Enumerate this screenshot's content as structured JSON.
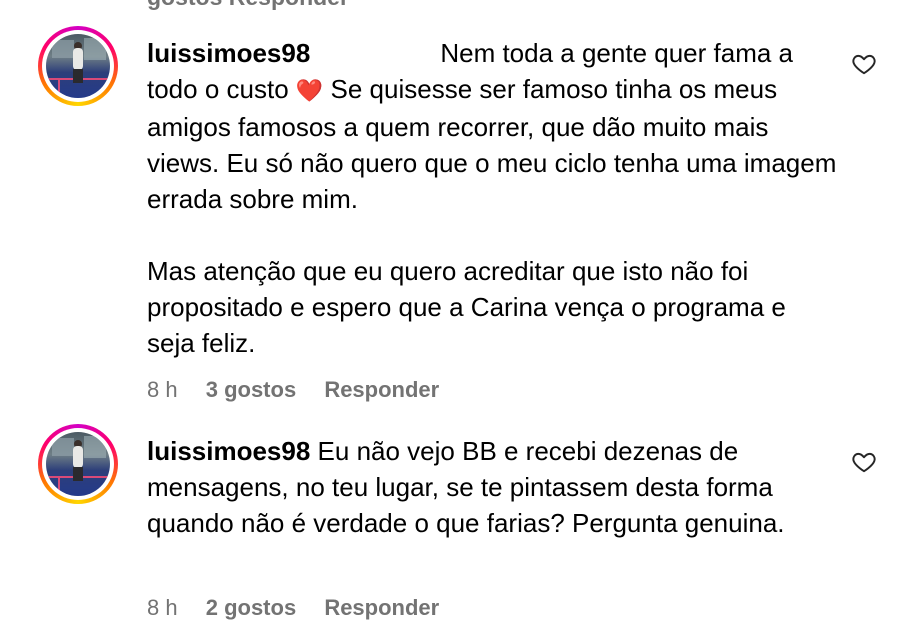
{
  "top_fragment": "gostos Responder",
  "comments": [
    {
      "username": "luissimoes98",
      "spacing": "                  ",
      "text_part1": "Nem toda a gente quer fama a todo o custo ",
      "emoji": "❤️",
      "text_part2": " Se quisesse ser famoso tinha os meus amigos famosos a quem recorrer, que dão muito mais views. Eu só não quero que o meu ciclo tenha uma imagem errada sobre mim.\n\nMas atenção que eu quero acreditar que isto não foi propositado e espero que a Carina vença o programa e seja feliz.",
      "time": "8 h",
      "likes": "3 gostos",
      "reply": "Responder",
      "like_icon": "heart-outline-icon"
    },
    {
      "username": "luissimoes98",
      "text": "Eu não vejo BB e recebi dezenas de mensagens, no teu lugar, se te pintassem desta forma quando não é verdade o que farias? Pergunta genuina.",
      "time": "8 h",
      "likes": "2 gostos",
      "reply": "Responder",
      "like_icon": "heart-outline-icon"
    }
  ],
  "colors": {
    "meta": "#737373",
    "text": "#000000",
    "story_ring": [
      "#d300c5",
      "#ff0069",
      "#ff7a00",
      "#ffd600"
    ]
  }
}
